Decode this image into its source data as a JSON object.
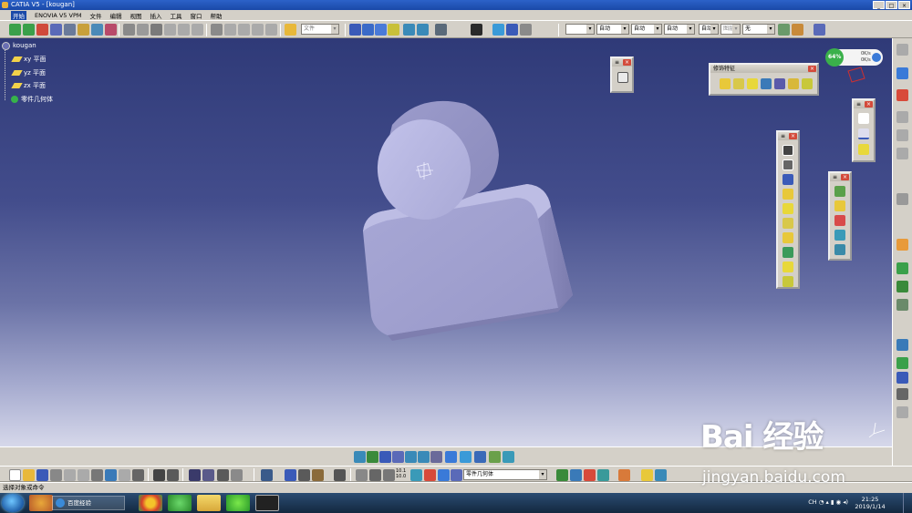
{
  "window": {
    "title": "CATIA V5 - [kougan]",
    "controls": [
      "_",
      "□",
      "×"
    ]
  },
  "menu": [
    "开始",
    "ENOVIA V5 VPM",
    "文件",
    "编辑",
    "视图",
    "插入",
    "工具",
    "窗口",
    "帮助"
  ],
  "top_toolbar": {
    "combo_file": "文件",
    "combo_line": "",
    "combo_auto1": "自动",
    "combo_auto2": "自动",
    "combo_auto3": "自动",
    "combo_auto4": "自动",
    "combo_layer": "图层",
    "combo_none": "无"
  },
  "tree": {
    "root": "kougan",
    "items": [
      "xy 平面",
      "yz 平面",
      "zx 平面",
      "零件几何体"
    ]
  },
  "floating_toolbars": {
    "dress_up": {
      "title": "修饰特征"
    },
    "small": {
      "title": "≡"
    },
    "sketch": {
      "title": "≡"
    },
    "features": {
      "title": "≡"
    },
    "transform": {
      "title": "≡"
    },
    "wireframe": {
      "title": "≡"
    }
  },
  "bottom_toolbar": {
    "body_combo": "零件几何体",
    "scale_label": "10.1 10.0"
  },
  "compass": {
    "percent": "64%",
    "rate1": "0K/s",
    "rate2": "0K/s"
  },
  "status": {
    "text": "选择对象或命令"
  },
  "taskbar": {
    "ie_label": "百度经验",
    "tray_text": "CH",
    "time": "21:25",
    "date": "2019/1/14"
  },
  "watermark": {
    "logo": "Bai 经验",
    "url": "jingyan.baidu.com"
  },
  "colors": {
    "title_bar": "#1a49a8",
    "viewport_top": "#2f3a78",
    "viewport_bottom": "#d6d8ea",
    "part_fill": "#a9aad6",
    "part_shadow": "#8a8bbd",
    "tree_text": "#ffffff"
  }
}
